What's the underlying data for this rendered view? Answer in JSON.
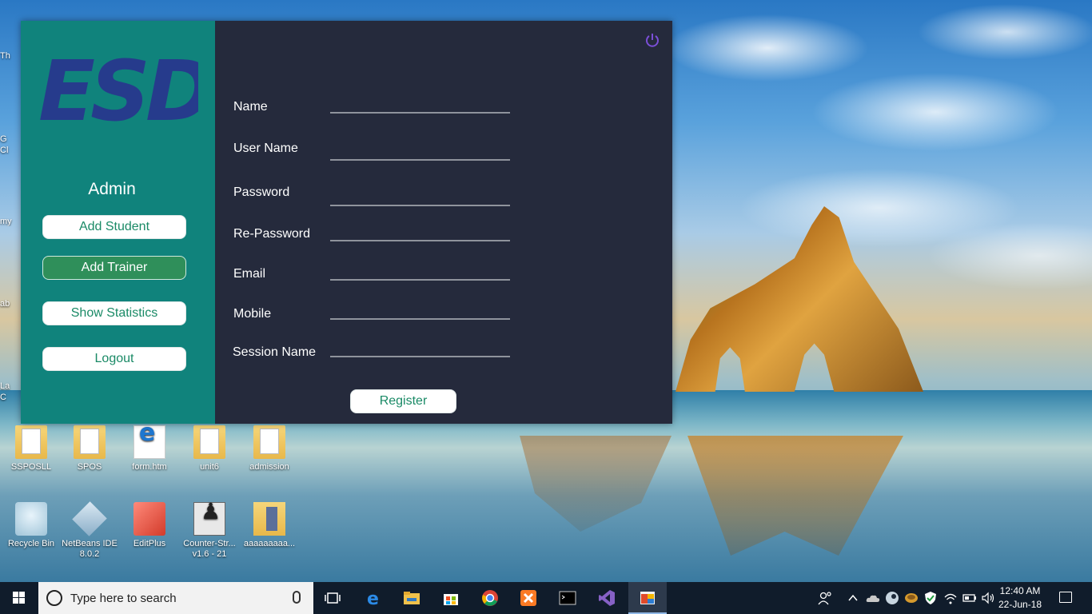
{
  "desktop": {
    "icons": [
      {
        "label": "SSPOSLL"
      },
      {
        "label": "SPOS"
      },
      {
        "label": "form.htm"
      },
      {
        "label": "unit6"
      },
      {
        "label": "admission"
      },
      {
        "label": "Recycle Bin"
      },
      {
        "label": "NetBeans IDE 8.0.2"
      },
      {
        "label": "EditPlus"
      },
      {
        "label": "Counter-Str... v1.6 - 21"
      },
      {
        "label": "aaaaaaaaa..."
      }
    ],
    "partial_labels": [
      "Th",
      "G",
      "Cl",
      "my",
      "ab",
      "La",
      "C"
    ]
  },
  "app": {
    "sidebar": {
      "role_label": "Admin",
      "buttons": [
        {
          "label": "Add Student"
        },
        {
          "label": "Add Trainer"
        },
        {
          "label": "Show Statistics"
        },
        {
          "label": "Logout"
        }
      ],
      "active_button": "Add Trainer",
      "logo_text": "ESD"
    },
    "form": {
      "fields": [
        {
          "label": "Name",
          "value": ""
        },
        {
          "label": "User Name",
          "value": ""
        },
        {
          "label": "Password",
          "value": ""
        },
        {
          "label": "Re-Password",
          "value": ""
        },
        {
          "label": "Email",
          "value": ""
        },
        {
          "label": "Mobile",
          "value": ""
        },
        {
          "label": "Session Name",
          "value": ""
        }
      ],
      "submit_label": "Register"
    },
    "colors": {
      "sidebar": "#10837c",
      "main": "#252a3c",
      "logo": "#263b8c",
      "button_text": "#1a8a66",
      "active_button": "#2f8f5a",
      "power_icon": "#7b4fd8"
    }
  },
  "taskbar": {
    "search_placeholder": "Type here to search",
    "apps": [
      "task-view",
      "edge",
      "file-explorer",
      "store",
      "chrome",
      "xampp",
      "command-prompt",
      "visual-studio",
      "app-window"
    ],
    "clock": {
      "time": "12:40 AM",
      "date": "22-Jun-18"
    }
  }
}
